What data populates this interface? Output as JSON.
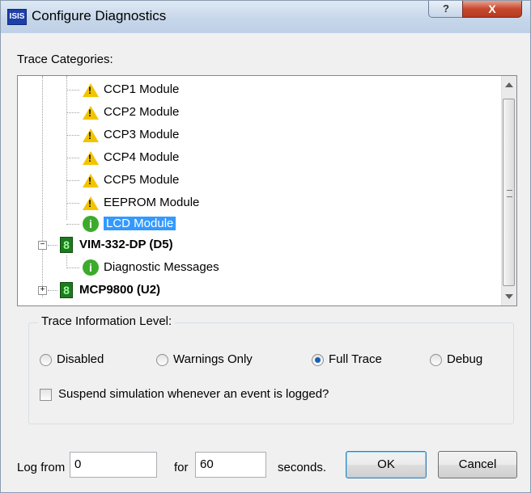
{
  "window": {
    "title": "Configure Diagnostics",
    "app_icon_text": "ISIS",
    "help_label": "?",
    "close_label": "X"
  },
  "trace_categories": {
    "label": "Trace Categories:",
    "items": [
      {
        "label": "CCP1 Module",
        "icon": "warning-icon"
      },
      {
        "label": "CCP2 Module",
        "icon": "warning-icon"
      },
      {
        "label": "CCP3 Module",
        "icon": "warning-icon"
      },
      {
        "label": "CCP4 Module",
        "icon": "warning-icon"
      },
      {
        "label": "CCP5 Module",
        "icon": "warning-icon"
      },
      {
        "label": "EEPROM Module",
        "icon": "warning-icon"
      },
      {
        "label": "LCD Module",
        "icon": "info-icon",
        "selected": true
      },
      {
        "label": "VIM-332-DP (D5)",
        "icon": "chip-icon",
        "expander": "−"
      },
      {
        "label": "Diagnostic Messages",
        "icon": "info-icon"
      },
      {
        "label": "MCP9800 (U2)",
        "icon": "chip-icon",
        "expander": "+"
      }
    ]
  },
  "trace_level": {
    "label": "Trace Information Level:",
    "options": [
      {
        "label": "Disabled",
        "selected": false
      },
      {
        "label": "Warnings Only",
        "selected": false
      },
      {
        "label": "Full Trace",
        "selected": true
      },
      {
        "label": "Debug",
        "selected": false
      }
    ],
    "suspend_label": "Suspend simulation whenever an event is logged?",
    "suspend_checked": false
  },
  "log": {
    "from_label": "Log from",
    "from_value": "0",
    "for_label": "for",
    "for_value": "60",
    "seconds_label": "seconds."
  },
  "buttons": {
    "ok": "OK",
    "cancel": "Cancel"
  },
  "colors": {
    "selection": "#3399ff",
    "warning": "#f2c400",
    "info": "#3cab2b",
    "close": "#c7492e"
  }
}
